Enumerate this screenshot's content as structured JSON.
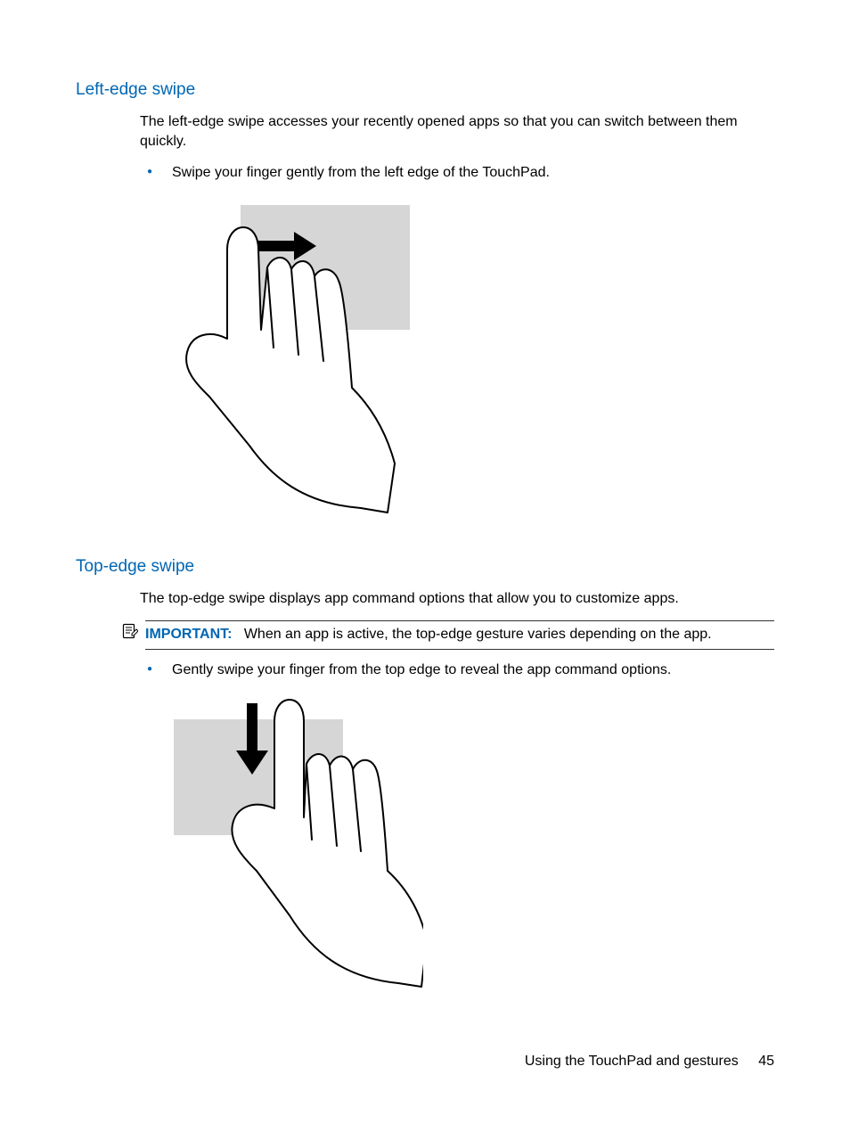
{
  "section1": {
    "heading": "Left-edge swipe",
    "intro": "The left-edge swipe accesses your recently opened apps so that you can switch between them quickly.",
    "bullet": "Swipe your finger gently from the left edge of the TouchPad."
  },
  "section2": {
    "heading": "Top-edge swipe",
    "intro": "The top-edge swipe displays app command options that allow you to customize apps.",
    "important_label": "IMPORTANT:",
    "important_text": "When an app is active, the top-edge gesture varies depending on the app.",
    "bullet": "Gently swipe your finger from the top edge to reveal the app command options."
  },
  "footer": {
    "section_title": "Using the TouchPad and gestures",
    "page_number": "45"
  }
}
